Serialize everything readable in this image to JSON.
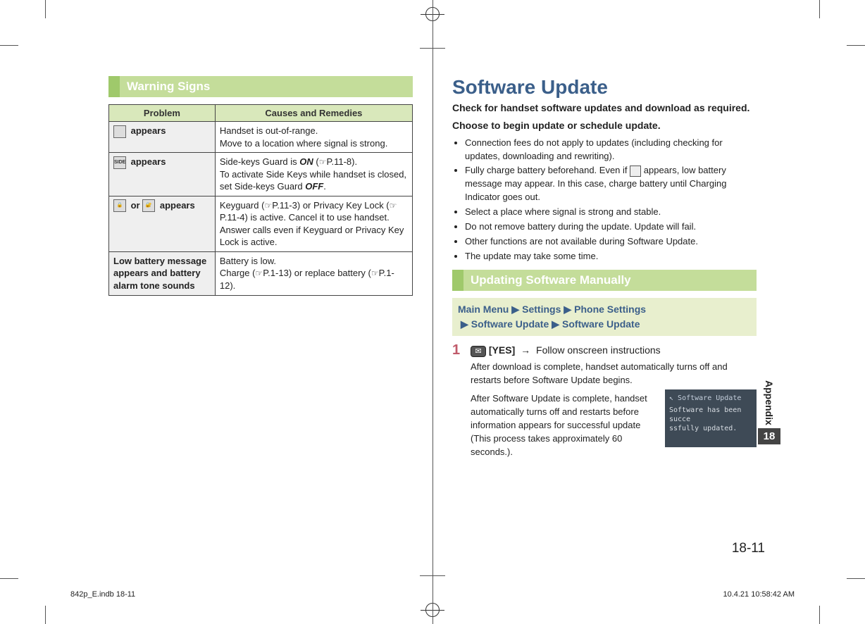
{
  "left": {
    "section_title": "Warning Signs",
    "table": {
      "headers": {
        "problem": "Problem",
        "remedy": "Causes and Remedies"
      },
      "rows": [
        {
          "icon_label": "out-of-range-icon",
          "problem_suffix": " appears",
          "remedy": "Handset is out-of-range.\nMove to a location where signal is strong."
        },
        {
          "icon_label": "side-keys-icon",
          "problem_suffix": " appears",
          "remedy_parts": {
            "a": "Side-keys Guard is ",
            "on": "ON",
            "b": " (",
            "ref1": "P.11-8",
            "c": ").\nTo activate Side Keys while handset is closed, set Side-keys Guard ",
            "off": "OFF",
            "d": "."
          }
        },
        {
          "icon_label_a": "lock-icon",
          "or_text": " or ",
          "icon_label_b": "privacy-lock-icon",
          "problem_suffix": " appears",
          "remedy_parts": {
            "a": "Keyguard (",
            "ref1": "P.11-3",
            "b": ") or Privacy Key Lock (",
            "ref2": "P.11-4",
            "c": ") is active. Cancel it to use handset. Answer calls even if Keyguard or Privacy Key Lock is active."
          }
        },
        {
          "problem_text": "Low battery message appears and battery alarm tone sounds",
          "remedy_parts": {
            "a": "Battery is low.\nCharge (",
            "ref1": "P.1-13",
            "b": ") or replace battery (",
            "ref2": "P.1-12",
            "c": ")."
          }
        }
      ]
    }
  },
  "right": {
    "title": "Software Update",
    "lead1": "Check for handset software updates and download as required.",
    "lead2": "Choose to begin update or schedule update.",
    "bullets": [
      "Connection fees do not apply to updates (including checking for updates, downloading and rewriting).",
      {
        "a": "Fully charge battery beforehand. Even if ",
        "icon": "battery-icon",
        "b": " appears, low battery message may appear. In this case, charge battery until Charging Indicator goes out."
      },
      "Select a place where signal is strong and stable.",
      "Do not remove battery during the update. Update will fail.",
      "Other functions are not available during Software Update.",
      "The update may take some time."
    ],
    "section_title": "Updating Software Manually",
    "nav": {
      "parts": [
        "Main Menu",
        "Settings",
        "Phone Settings",
        "Software Update",
        "Software Update"
      ]
    },
    "step": {
      "num": "1",
      "key_icon": "mail-key-icon",
      "yes": "[YES]",
      "follow": "Follow onscreen instructions",
      "sub1": "After download is complete, handset automatically turns off and restarts before Software Update begins.",
      "sub2": "After Software Update is complete, handset automatically turns off and restarts before information appears for successful update (This process takes approximately 60 seconds.).",
      "screen": {
        "title": "Software Update",
        "body": "Software has been succe\nssfully updated."
      }
    }
  },
  "thumb": {
    "label": "Appendix",
    "num": "18"
  },
  "page_number": "18-11",
  "footer": {
    "left": "842p_E.indb   18-11",
    "right": "10.4.21   10:58:42 AM"
  }
}
